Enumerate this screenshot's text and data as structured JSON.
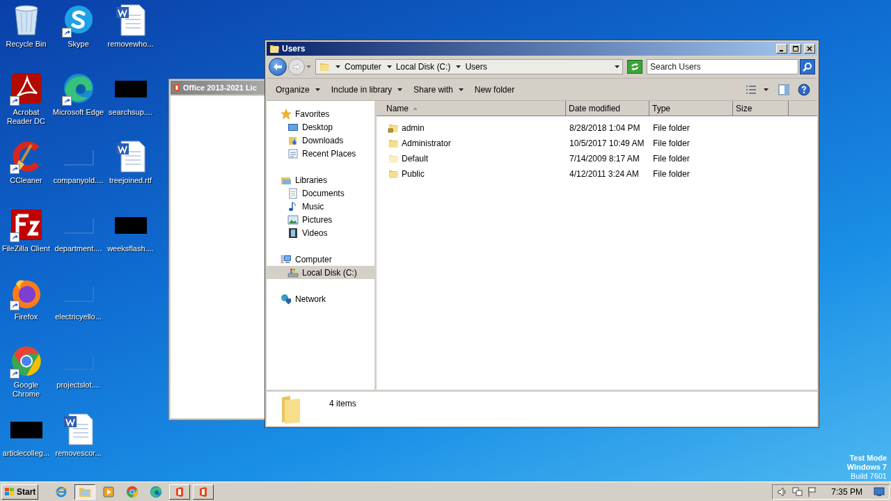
{
  "desktop": {
    "icon_columns": [
      [
        {
          "label": "Recycle Bin",
          "kind": "recycle",
          "shortcut": false
        },
        {
          "label": "Acrobat Reader DC",
          "kind": "acrobat",
          "shortcut": true
        },
        {
          "label": "CCleaner",
          "kind": "ccleaner",
          "shortcut": true
        },
        {
          "label": "FileZilla Client",
          "kind": "filezilla",
          "shortcut": true
        },
        {
          "label": "Firefox",
          "kind": "firefox",
          "shortcut": true
        },
        {
          "label": "Google Chrome",
          "kind": "chrome",
          "shortcut": true
        },
        {
          "label": "articlecolleg...",
          "kind": "black",
          "shortcut": false
        }
      ],
      [
        {
          "label": "Skype",
          "kind": "skype",
          "shortcut": true
        },
        {
          "label": "Microsoft Edge",
          "kind": "edge",
          "shortcut": true
        },
        {
          "label": "companyold....",
          "kind": "blank",
          "shortcut": false
        },
        {
          "label": "department....",
          "kind": "blank",
          "shortcut": false
        },
        {
          "label": "electricyello...",
          "kind": "blank",
          "shortcut": false
        },
        {
          "label": "projectslot....",
          "kind": "blank",
          "shortcut": false
        },
        {
          "label": "removescor...",
          "kind": "word",
          "shortcut": false
        }
      ],
      [
        {
          "label": "removewho...",
          "kind": "word",
          "shortcut": false
        },
        {
          "label": "searchsup....",
          "kind": "black",
          "shortcut": false
        },
        {
          "label": "treejoined.rtf",
          "kind": "word",
          "shortcut": false
        },
        {
          "label": "weeksflash....",
          "kind": "black",
          "shortcut": false
        }
      ]
    ],
    "mode_notice": [
      {
        "text": "Test Mode",
        "bold": true
      },
      {
        "text": "Windows 7",
        "bold": true
      },
      {
        "text": "Build 7601",
        "bold": false
      }
    ]
  },
  "background_window": {
    "title": "Office 2013-2021 Lic"
  },
  "explorer": {
    "title": "Users",
    "address": {
      "segments": [
        "Computer",
        "Local Disk (C:)",
        "Users"
      ],
      "search_placeholder": "Search Users"
    },
    "toolbar": [
      {
        "label": "Organize",
        "dropdown": true
      },
      {
        "label": "Include in library",
        "dropdown": true
      },
      {
        "label": "Share with",
        "dropdown": true
      },
      {
        "label": "New folder",
        "dropdown": false
      }
    ],
    "nav": [
      {
        "label": "Favorites",
        "kind": "star",
        "selected": false,
        "children": [
          {
            "label": "Desktop",
            "kind": "desktop",
            "selected": false
          },
          {
            "label": "Downloads",
            "kind": "downloads",
            "selected": false
          },
          {
            "label": "Recent Places",
            "kind": "recent",
            "selected": false
          }
        ]
      },
      {
        "label": "Libraries",
        "kind": "libraries",
        "selected": false,
        "children": [
          {
            "label": "Documents",
            "kind": "documents",
            "selected": false
          },
          {
            "label": "Music",
            "kind": "music",
            "selected": false
          },
          {
            "label": "Pictures",
            "kind": "pictures",
            "selected": false
          },
          {
            "label": "Videos",
            "kind": "videos",
            "selected": false
          }
        ]
      },
      {
        "label": "Computer",
        "kind": "computer",
        "selected": false,
        "children": [
          {
            "label": "Local Disk (C:)",
            "kind": "disk",
            "selected": true
          }
        ]
      },
      {
        "label": "Network",
        "kind": "network",
        "selected": false
      }
    ],
    "columns": [
      {
        "label": "Name",
        "sorted": true
      },
      {
        "label": "Date modified",
        "sorted": false
      },
      {
        "label": "Type",
        "sorted": false
      },
      {
        "label": "Size",
        "sorted": false
      }
    ],
    "rows": [
      {
        "name": "admin",
        "date": "8/28/2018 1:04 PM",
        "type": "File folder",
        "locked": true,
        "hidden": false
      },
      {
        "name": "Administrator",
        "date": "10/5/2017 10:49 AM",
        "type": "File folder",
        "locked": false,
        "hidden": false
      },
      {
        "name": "Default",
        "date": "7/14/2009 8:17 AM",
        "type": "File folder",
        "locked": false,
        "hidden": true
      },
      {
        "name": "Public",
        "date": "4/12/2011 3:24 AM",
        "type": "File folder",
        "locked": false,
        "hidden": false
      }
    ],
    "status": "4 items"
  },
  "taskbar": {
    "start_label": "Start",
    "items": [
      {
        "kind": "ie",
        "selected": false
      },
      {
        "kind": "explorer",
        "selected": true
      },
      {
        "kind": "media",
        "selected": false
      },
      {
        "kind": "chrome",
        "selected": false
      },
      {
        "kind": "edge",
        "selected": false
      },
      {
        "kind": "office",
        "selected": false
      },
      {
        "kind": "office",
        "selected": false
      }
    ],
    "clock": "7:35 PM"
  }
}
